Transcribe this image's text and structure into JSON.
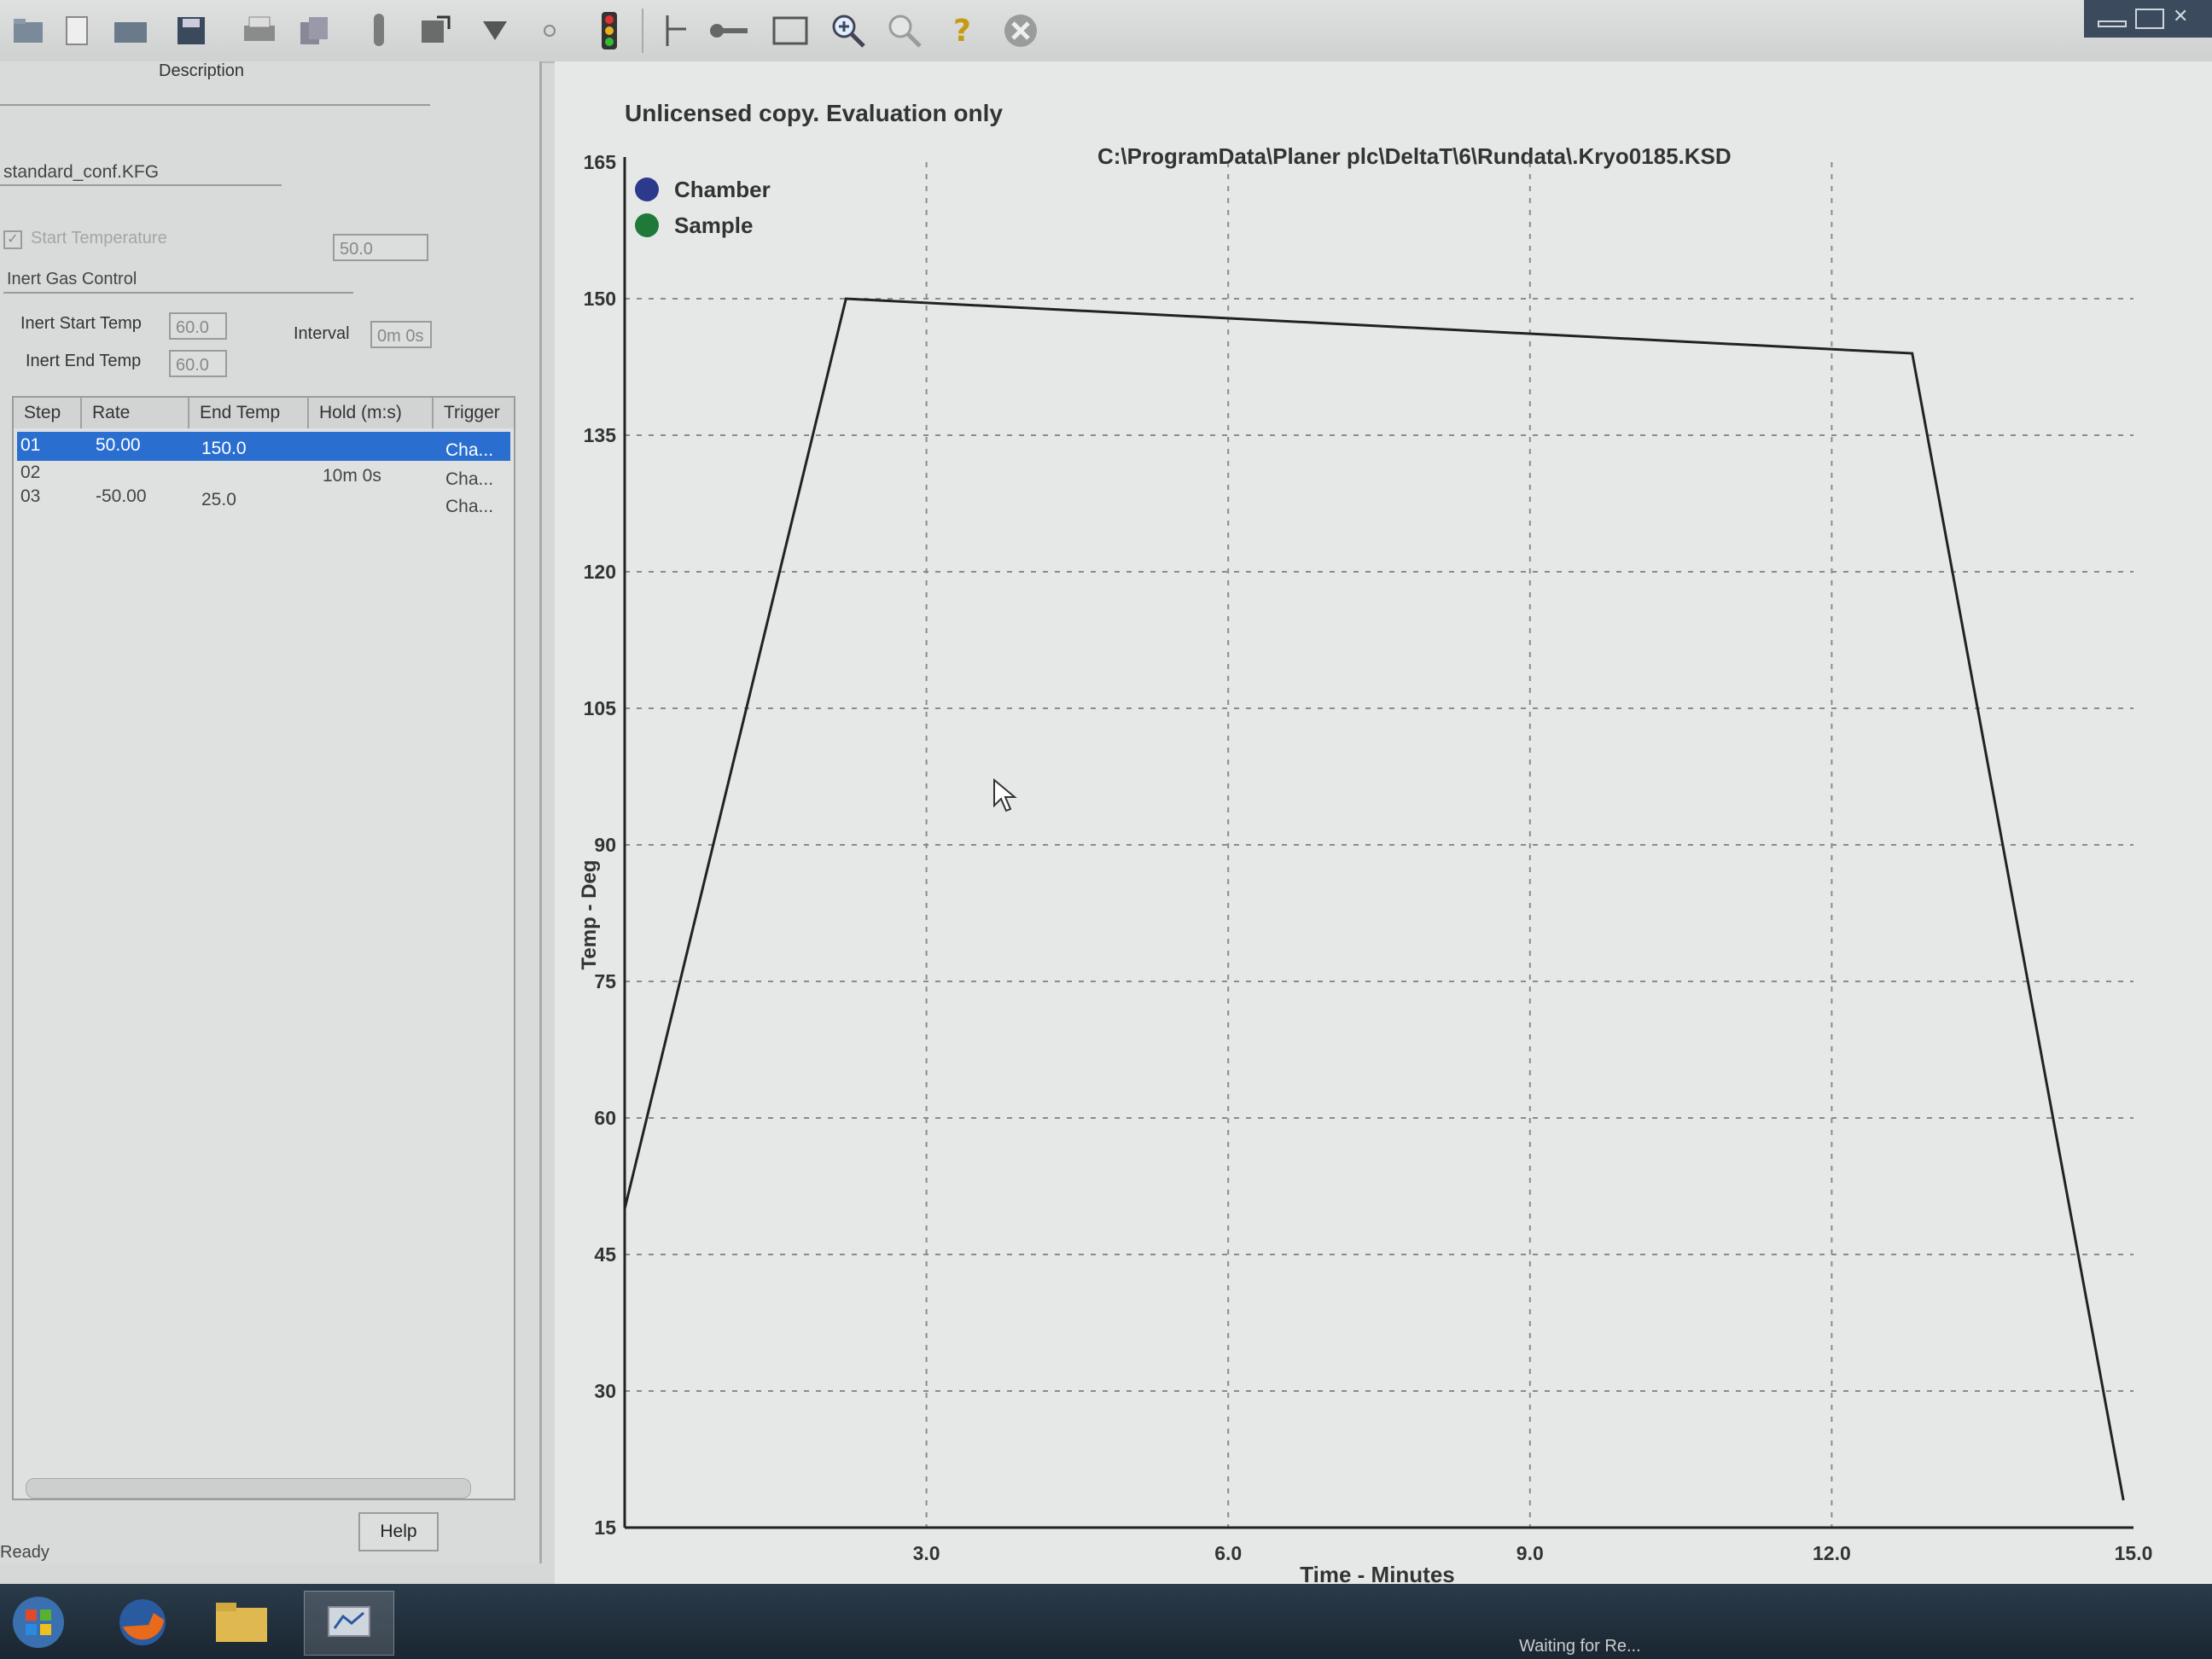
{
  "left_panel": {
    "description_label": "Description",
    "config_file": "standard_conf.KFG",
    "start_temperature_label": "Start Temperature",
    "start_temperature_value": "50.0",
    "inert_gas_label": "Inert Gas Control",
    "inert_start_label": "Inert Start Temp",
    "inert_start_value": "60.0",
    "interval_label": "Interval",
    "interval_value": "0m 0s",
    "inert_end_label": "Inert End Temp",
    "inert_end_value": "60.0",
    "help_label": "Help"
  },
  "steps_table": {
    "headers": [
      "Step",
      "Rate",
      "End Temp",
      "Hold (m:s)",
      "Trigger"
    ],
    "rows": [
      {
        "step": "01",
        "rate": "50.00",
        "end_temp": "150.0",
        "hold": "",
        "trigger": "Cha..."
      },
      {
        "step": "02",
        "rate": "",
        "end_temp": "",
        "hold": "10m 0s",
        "trigger": "Cha..."
      },
      {
        "step": "03",
        "rate": "-50.00",
        "end_temp": "25.0",
        "hold": "",
        "trigger": "Cha..."
      }
    ]
  },
  "status": {
    "left": "Ready",
    "right": "Waiting for Re..."
  },
  "chart_header": {
    "license": "Unlicensed copy.  Evaluation only",
    "file_path": "C:\\ProgramData\\Planer plc\\DeltaT\\6\\Rundata\\.Kryo0185.KSD"
  },
  "chart_data": {
    "type": "line",
    "ylabel": "Temp - Deg",
    "xlabel": "Time - Minutes",
    "ylim": [
      15,
      165
    ],
    "xlim": [
      0,
      15
    ],
    "yticks": [
      "165",
      "150",
      "135",
      "120",
      "105",
      "90",
      "75",
      "60",
      "45",
      "30",
      "15"
    ],
    "xticks": [
      "3.0",
      "6.0",
      "9.0",
      "12.0",
      "15.0"
    ],
    "grid": true,
    "legend": "top-left",
    "series": [
      {
        "name": "Chamber",
        "color": "#2c3a8c",
        "x": [
          0,
          2.2,
          12.8,
          14.9
        ],
        "y": [
          50,
          150,
          144,
          18
        ]
      },
      {
        "name": "Sample",
        "color": "#1f7a3a",
        "x": [],
        "y": []
      }
    ]
  }
}
